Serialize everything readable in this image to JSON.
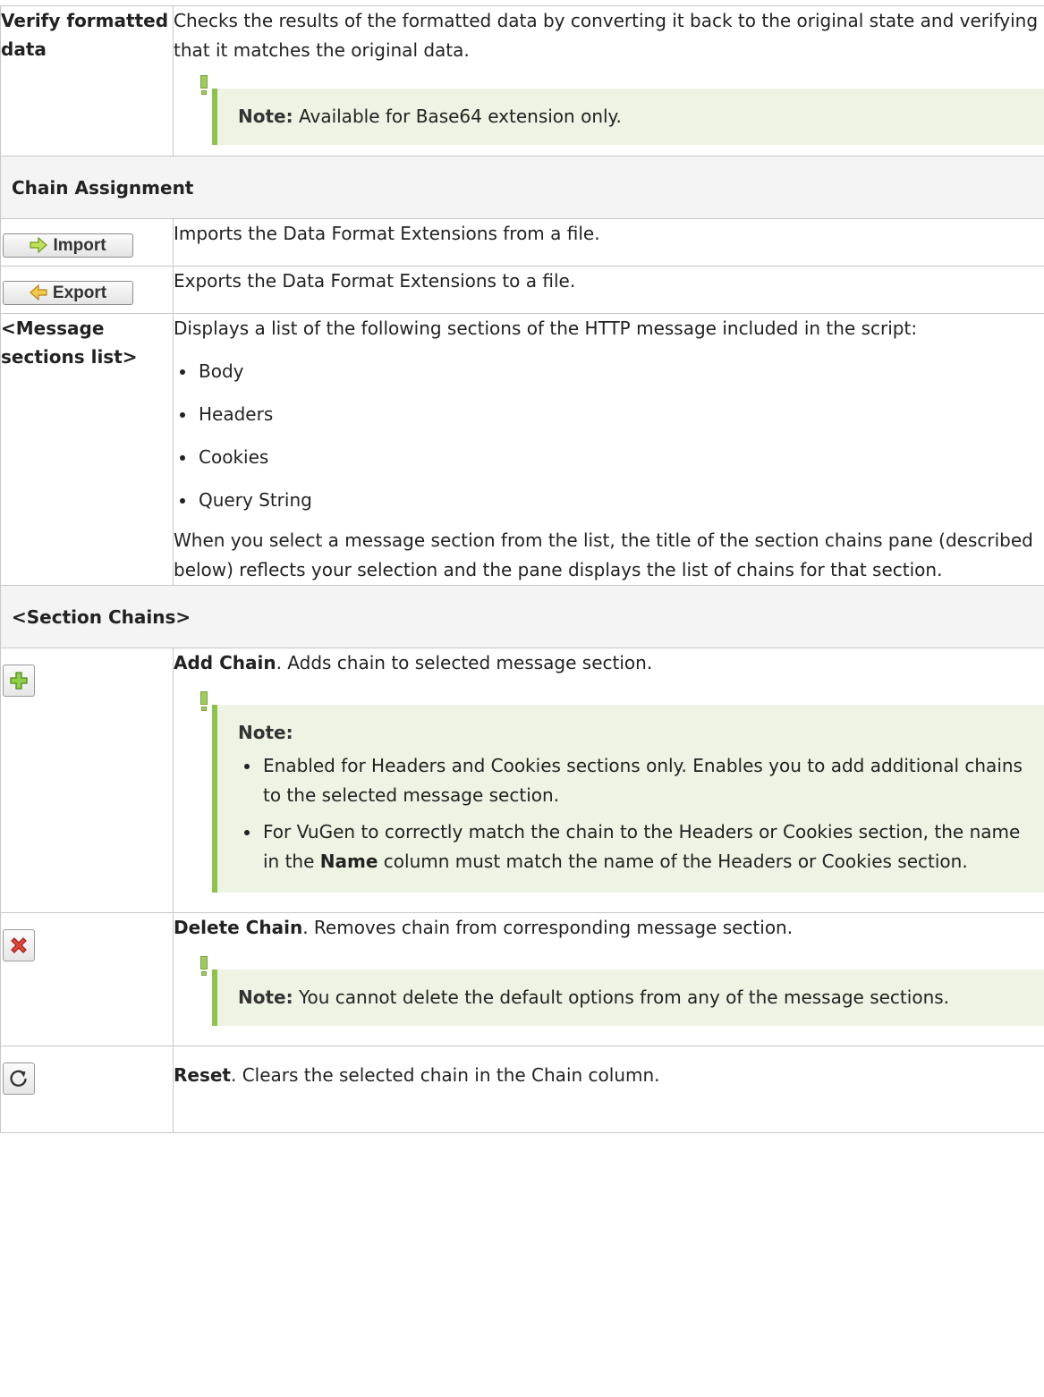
{
  "rows": {
    "verify": {
      "label": "Verify formatted data",
      "desc": "Checks the results of the formatted data by converting it back to the original state and verifying that it matches the original data.",
      "note_label": "Note:",
      "note_text": "Available for Base64 extension only."
    },
    "chain_assignment": {
      "header": "Chain Assignment"
    },
    "import": {
      "button_label": "Import",
      "desc": "Imports the Data Format Extensions from a file."
    },
    "export": {
      "button_label": "Export",
      "desc": "Exports the Data Format Extensions to a file."
    },
    "message_sections": {
      "label": "<Message sections list>",
      "intro": "Displays a list of the following sections of the HTTP message included in the script:",
      "items": [
        "Body",
        "Headers",
        "Cookies",
        "Query String"
      ],
      "outro": "When you select a message section from the list, the title of the section chains pane (described below) reflects your selection and the pane displays the list of chains for that section."
    },
    "section_chains": {
      "header": "<Section Chains>"
    },
    "add_chain": {
      "title": "Add Chain",
      "desc": ". Adds chain to selected message section.",
      "note_label": "Note:",
      "note_items": [
        "Enabled for Headers and Cookies sections only. Enables you to add additional chains to the selected message section.",
        {
          "before": "For VuGen to correctly match the chain to the Headers or Cookies section, the name in the ",
          "bold": "Name",
          "after": " column must match the name of the Headers or Cookies section."
        }
      ]
    },
    "delete_chain": {
      "title": "Delete Chain",
      "desc": ". Removes chain from corresponding message section.",
      "note_label": "Note:",
      "note_text": "You cannot delete the default options from any of the message sections."
    },
    "reset": {
      "title": "Reset",
      "desc": ". Clears the selected chain in the Chain column."
    }
  },
  "icons": {
    "import": "arrow-right-icon",
    "export": "arrow-left-icon",
    "add": "plus-icon",
    "delete": "red-x-icon",
    "reset": "refresh-icon",
    "note": "note-marker-icon"
  },
  "colors": {
    "note_bg": "#eef4e3",
    "note_border": "#8fc14d",
    "table_border": "#c8c8c8",
    "header_bg": "#f4f4f4"
  }
}
